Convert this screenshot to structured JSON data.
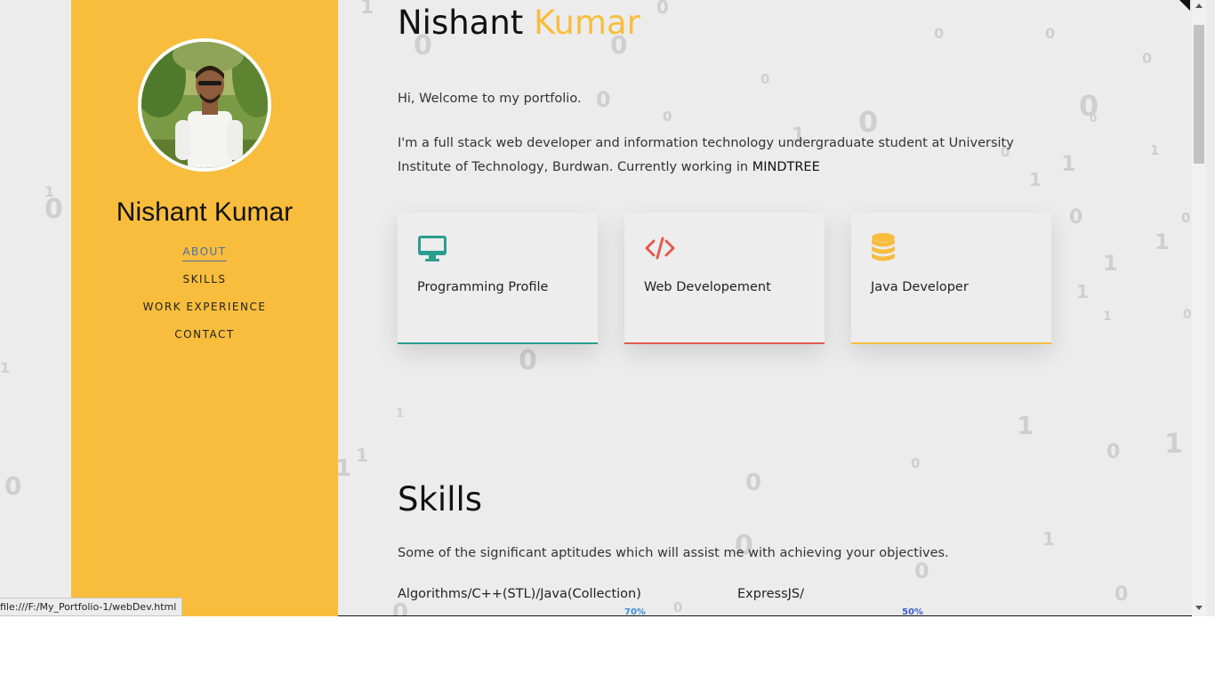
{
  "status_bar": {
    "url": "file:///F:/My_Portfolio-1/webDev.html"
  },
  "sidebar": {
    "name": "Nishant Kumar",
    "nav": [
      {
        "label": "ABOUT",
        "active": true
      },
      {
        "label": "SKILLS",
        "active": false
      },
      {
        "label": "WORK EXPERIENCE",
        "active": false
      },
      {
        "label": "CONTACT",
        "active": false
      }
    ]
  },
  "main": {
    "title_first": "Nishant",
    "title_last": "Kumar",
    "welcome": "Hi, Welcome to my portfolio.",
    "intro": "I'm a full stack web developer and information technology undergraduate student at University Institute of Technology, Burdwan. Currently working in",
    "company": "MINDTREE",
    "cards": [
      {
        "label": "Programming Profile",
        "icon": "monitor-icon",
        "accent": "#2a9d8f"
      },
      {
        "label": "Web Developement",
        "icon": "code-icon",
        "accent": "#e05a4f"
      },
      {
        "label": "Java Developer",
        "icon": "database-icon",
        "accent": "#f8bd3d"
      }
    ],
    "skills_title": "Skills",
    "skills_desc": "Some of the significant aptitudes which will assist me with achieving your objectives.",
    "skills": [
      {
        "name": "Algorithms/C++(STL)/Java(Collection)",
        "percent": "70%"
      },
      {
        "name": "ExpressJS/",
        "percent": "50%"
      }
    ]
  },
  "colors": {
    "accent": "#f8bd3d",
    "background": "#ececec",
    "digit": "#cfcfcf"
  }
}
